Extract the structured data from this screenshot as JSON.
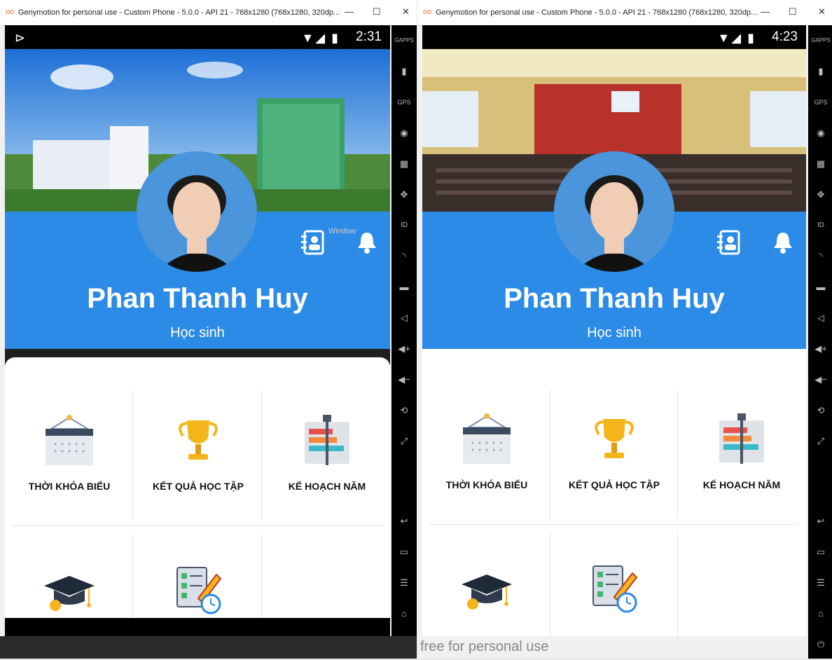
{
  "left": {
    "window_title": "Genymotion for personal use - Custom Phone - 5.0.0 - API 21 - 768x1280 (768x1280, 320dp...",
    "time": "2:31",
    "name": "Phan Thanh Huy",
    "role": "Học sinh",
    "watermark": "Window"
  },
  "right": {
    "window_title": "Genymotion for personal use - Custom Phone - 5.0.0 - API 21 - 768x1280 (768x1280, 320dp...",
    "time": "4:23",
    "name": "Phan Thanh Huy",
    "role": "Học sinh",
    "watermark": "free for personal use"
  },
  "menu": [
    {
      "label": "THỜI KHÓA BIỂU",
      "icon": "calendar-icon"
    },
    {
      "label": "KẾT QUẢ HỌC TẬP",
      "icon": "trophy-icon"
    },
    {
      "label": "KẾ HOẠCH NĂM",
      "icon": "chart-board-icon"
    },
    {
      "label": "",
      "icon": "graduation-cap-icon"
    },
    {
      "label": "",
      "icon": "schedule-checklist-icon"
    }
  ],
  "sidebar_labels": {
    "gapps": "GAPPS",
    "gps": "GPS",
    "id": "ID"
  },
  "colors": {
    "primary_blue": "#2b8be6",
    "card_white": "#ffffff"
  }
}
